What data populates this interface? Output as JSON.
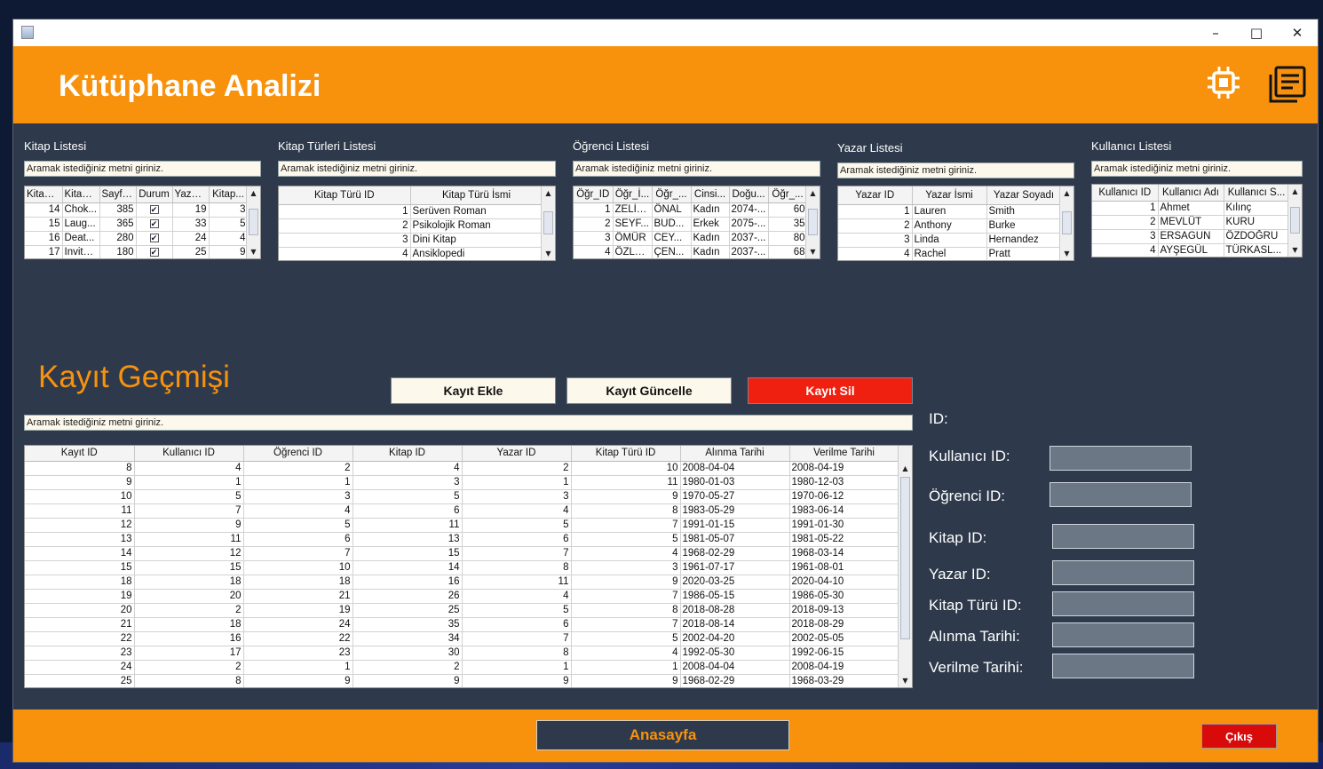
{
  "colors": {
    "accent": "#f8920d",
    "panel": "#2e3a4b",
    "danger": "#f02010",
    "button_light": "#fdf8ec"
  },
  "window": {
    "minimize_glyph": "–",
    "maximize_glyph": "□",
    "close_glyph": "✕"
  },
  "header": {
    "title": "Kütüphane Analizi",
    "icons": [
      "processor-chip-icon",
      "report-document-icon"
    ]
  },
  "search_placeholder": "Aramak istediğiniz metni giriniz.",
  "lists": {
    "kitap": {
      "title": "Kitap Listesi",
      "columns": [
        "Kitap ...",
        "Kitap ...",
        "Sayfa...",
        "Durum",
        "Yazar...",
        "Kitap..."
      ],
      "rows": [
        [
          "14",
          "Chok...",
          "385",
          true,
          "19",
          "3"
        ],
        [
          "15",
          "Laug...",
          "365",
          true,
          "33",
          "5"
        ],
        [
          "16",
          "Deat...",
          "280",
          true,
          "24",
          "4"
        ],
        [
          "17",
          "Invite...",
          "180",
          true,
          "25",
          "9"
        ]
      ]
    },
    "kitap_turleri": {
      "title": "Kitap Türleri Listesi",
      "columns": [
        "Kitap Türü ID",
        "Kitap Türü İsmi"
      ],
      "rows": [
        [
          "1",
          "Serüven Roman"
        ],
        [
          "2",
          "Psikolojik Roman"
        ],
        [
          "3",
          "Dini Kitap"
        ],
        [
          "4",
          "Ansiklopedi"
        ]
      ]
    },
    "ogrenci": {
      "title": "Öğrenci Listesi",
      "columns": [
        "Öğr_ID",
        "Öğr_İ...",
        "Öğr_...",
        "Cinsi...",
        "Doğu...",
        "Öğr_..."
      ],
      "rows": [
        [
          "1",
          "ZELİHA",
          "ÖNAL",
          "Kadın",
          "2074-...",
          "60"
        ],
        [
          "2",
          "SEYF...",
          "BUD...",
          "Erkek",
          "2075-...",
          "35"
        ],
        [
          "3",
          "ÖMÜR",
          "CEY...",
          "Kadın",
          "2037-...",
          "80"
        ],
        [
          "4",
          "ÖZLEM",
          "ÇEN...",
          "Kadın",
          "2037-...",
          "68"
        ]
      ]
    },
    "yazar": {
      "title": "Yazar Listesi",
      "columns": [
        "Yazar ID",
        "Yazar İsmi",
        "Yazar Soyadı"
      ],
      "rows": [
        [
          "1",
          "Lauren",
          "Smith"
        ],
        [
          "2",
          "Anthony",
          "Burke"
        ],
        [
          "3",
          "Linda",
          "Hernandez"
        ],
        [
          "4",
          "Rachel",
          "Pratt"
        ]
      ]
    },
    "kullanici": {
      "title": "Kullanıcı Listesi",
      "columns": [
        "Kullanıcı ID",
        "Kullanıcı Adı",
        "Kullanıcı S..."
      ],
      "rows": [
        [
          "1",
          "Ahmet",
          "Kılınç"
        ],
        [
          "2",
          "MEVLÜT",
          "KURU"
        ],
        [
          "3",
          "ERSAGUN",
          "ÖZDOĞRU"
        ],
        [
          "4",
          "AYŞEGÜL",
          "TÜRKASL..."
        ]
      ]
    }
  },
  "history": {
    "title": "Kayıt Geçmişi",
    "buttons": {
      "add": "Kayıt Ekle",
      "update": "Kayıt Güncelle",
      "delete": "Kayıt Sil"
    },
    "columns": [
      "Kayıt ID",
      "Kullanıcı ID",
      "Öğrenci ID",
      "Kitap ID",
      "Yazar ID",
      "Kitap Türü ID",
      "Alınma Tarihi",
      "Verilme Tarihi"
    ],
    "rows": [
      [
        "8",
        "4",
        "2",
        "4",
        "2",
        "10",
        "2008-04-04",
        "2008-04-19"
      ],
      [
        "9",
        "1",
        "1",
        "3",
        "1",
        "11",
        "1980-01-03",
        "1980-12-03"
      ],
      [
        "10",
        "5",
        "3",
        "5",
        "3",
        "9",
        "1970-05-27",
        "1970-06-12"
      ],
      [
        "11",
        "7",
        "4",
        "6",
        "4",
        "8",
        "1983-05-29",
        "1983-06-14"
      ],
      [
        "12",
        "9",
        "5",
        "11",
        "5",
        "7",
        "1991-01-15",
        "1991-01-30"
      ],
      [
        "13",
        "11",
        "6",
        "13",
        "6",
        "5",
        "1981-05-07",
        "1981-05-22"
      ],
      [
        "14",
        "12",
        "7",
        "15",
        "7",
        "4",
        "1968-02-29",
        "1968-03-14"
      ],
      [
        "15",
        "15",
        "10",
        "14",
        "8",
        "3",
        "1961-07-17",
        "1961-08-01"
      ],
      [
        "18",
        "18",
        "18",
        "16",
        "11",
        "9",
        "2020-03-25",
        "2020-04-10"
      ],
      [
        "19",
        "20",
        "21",
        "26",
        "4",
        "7",
        "1986-05-15",
        "1986-05-30"
      ],
      [
        "20",
        "2",
        "19",
        "25",
        "5",
        "8",
        "2018-08-28",
        "2018-09-13"
      ],
      [
        "21",
        "18",
        "24",
        "35",
        "6",
        "7",
        "2018-08-14",
        "2018-08-29"
      ],
      [
        "22",
        "16",
        "22",
        "34",
        "7",
        "5",
        "2002-04-20",
        "2002-05-05"
      ],
      [
        "23",
        "17",
        "23",
        "30",
        "8",
        "4",
        "1992-05-30",
        "1992-06-15"
      ],
      [
        "24",
        "2",
        "1",
        "2",
        "1",
        "1",
        "2008-04-04",
        "2008-04-19"
      ],
      [
        "25",
        "8",
        "9",
        "9",
        "9",
        "9",
        "1968-02-29",
        "1968-03-29"
      ]
    ]
  },
  "form": {
    "id_label": "ID:",
    "kullanici_id": "Kullanıcı ID:",
    "ogrenci_id": "Öğrenci ID:",
    "kitap_id": "Kitap ID:",
    "yazar_id": "Yazar ID:",
    "kitap_turu_id": "Kitap Türü ID:",
    "alinma_tarihi": "Alınma Tarihi:",
    "verilme_tarihi": "Verilme Tarihi:"
  },
  "footer": {
    "home": "Anasayfa",
    "exit": "Çıkış"
  }
}
